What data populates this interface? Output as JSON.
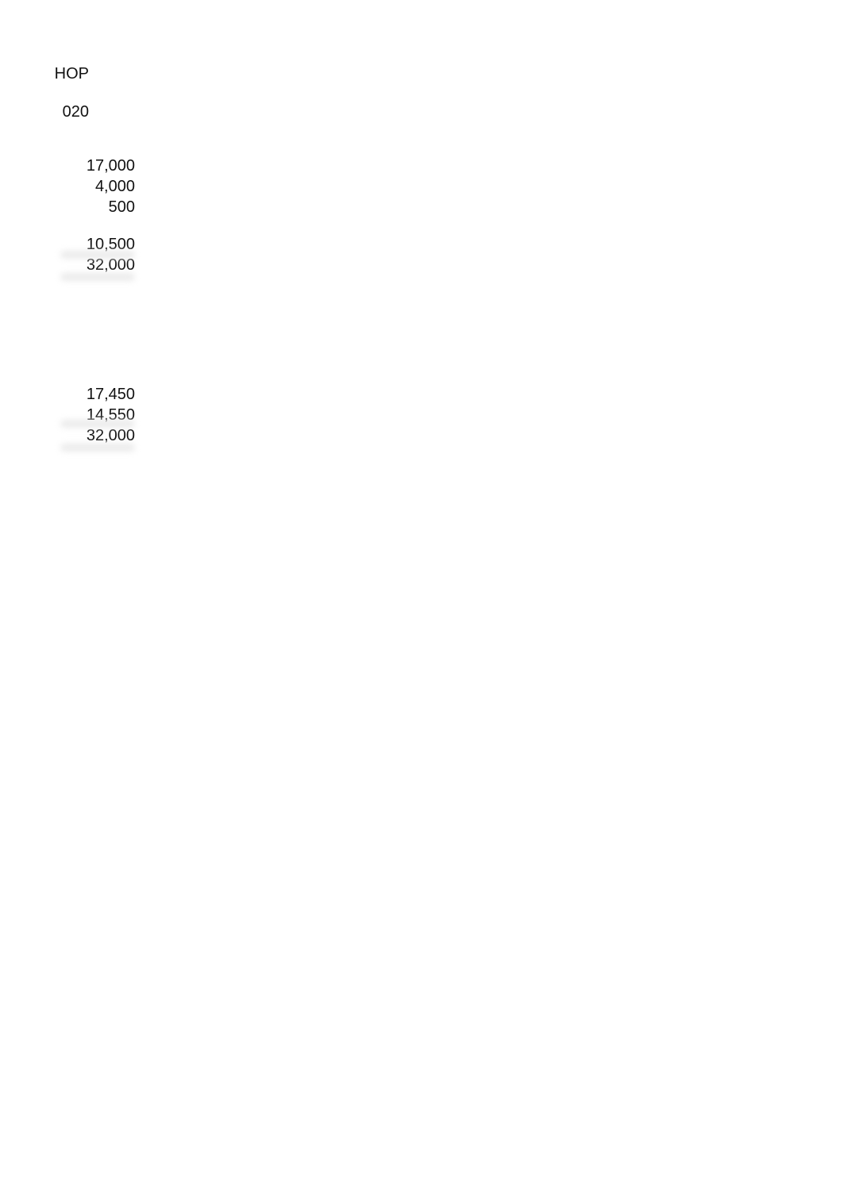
{
  "header": {
    "line1": "HOP",
    "line2": "020"
  },
  "block1": {
    "rows": [
      "17,000",
      "4,000",
      "500",
      "10,500",
      "32,000"
    ]
  },
  "block2": {
    "rows": [
      "17,450",
      "14,550",
      "32,000"
    ]
  }
}
